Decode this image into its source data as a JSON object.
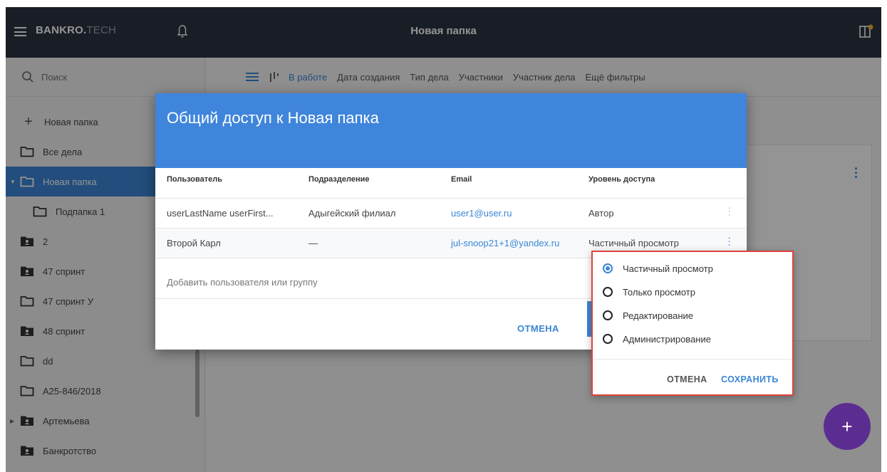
{
  "topbar": {
    "logo_bold": "BANKRO.",
    "logo_light": "TECH",
    "title": "Новая папка"
  },
  "sidebar": {
    "search_placeholder": "Поиск",
    "new_folder": "Новая папка",
    "items": [
      {
        "label": "Все дела",
        "icon": "folder-outline-icon"
      },
      {
        "label": "Новая папка",
        "icon": "folder-outline-icon",
        "active": true
      },
      {
        "label": "Подпапка 1",
        "icon": "folder-outline-icon"
      },
      {
        "label": "2",
        "icon": "shared-folder-icon"
      },
      {
        "label": "47 спринт",
        "icon": "shared-folder-icon"
      },
      {
        "label": "47 спринт У",
        "icon": "folder-outline-icon"
      },
      {
        "label": "48 спринт",
        "icon": "shared-folder-icon"
      },
      {
        "label": "dd",
        "icon": "folder-outline-icon"
      },
      {
        "label": "А25-846/2018",
        "icon": "folder-outline-icon"
      },
      {
        "label": "Артемьева",
        "icon": "shared-folder-icon"
      },
      {
        "label": "Банкротство",
        "icon": "shared-folder-icon"
      }
    ]
  },
  "filters": [
    "В работе",
    "Дата создания",
    "Тип дела",
    "Участники",
    "Участник дела",
    "Ещё фильтры"
  ],
  "dialog": {
    "title": "Общий доступ к Новая папка",
    "columns": [
      "Пользователь",
      "Подразделение",
      "Email",
      "Уровень доступа"
    ],
    "rows": [
      {
        "user": "userLastName userFirst...",
        "department": "Адыгейский филиал",
        "email": "user1@user.ru",
        "access": "Автор"
      },
      {
        "user": "Второй Карл",
        "department": "—",
        "email": "jul-snoop21+1@yandex.ru",
        "access": "Частичный просмотр"
      }
    ],
    "add_user": "Добавить пользователя или группу",
    "cancel": "ОТМЕНА"
  },
  "access_popup": {
    "options": [
      "Частичный просмотр",
      "Только просмотр",
      "Редактирование",
      "Администрирование"
    ],
    "selected": "Частичный просмотр",
    "cancel": "ОТМЕНА",
    "save": "СОХРАНИТЬ"
  },
  "colors": {
    "topbar": "#2b3340",
    "accent": "#3b86d6",
    "dialog_header": "#3f85db",
    "fab": "#5c2d91",
    "highlight_border": "#e0433a"
  },
  "fab_label": "+"
}
